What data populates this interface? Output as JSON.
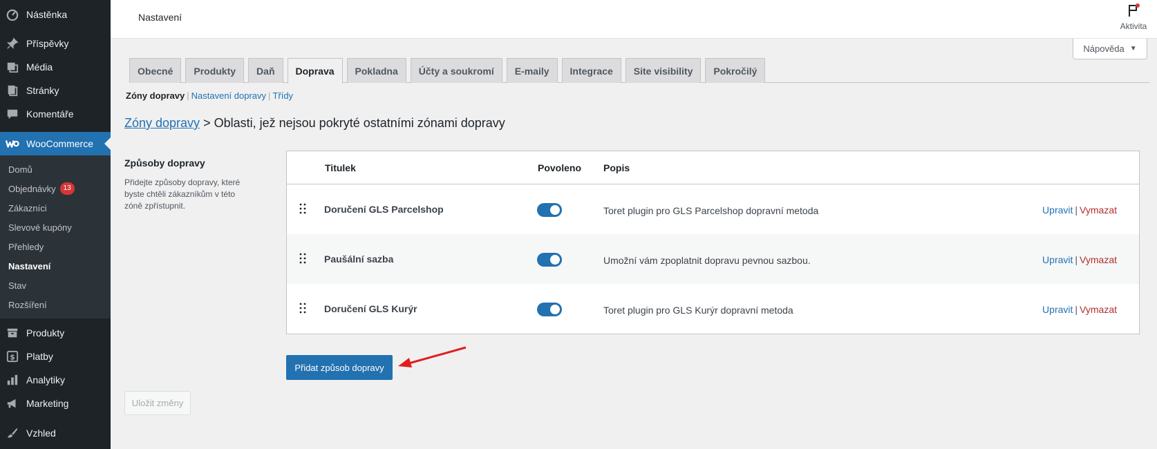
{
  "sidebar": {
    "items_top": [
      {
        "label": "Nástěnka",
        "icon": "dashboard-icon"
      },
      {
        "label": "Příspěvky",
        "icon": "pin-icon"
      },
      {
        "label": "Média",
        "icon": "media-icon"
      },
      {
        "label": "Stránky",
        "icon": "pages-icon"
      },
      {
        "label": "Komentáře",
        "icon": "comment-icon"
      }
    ],
    "woocommerce": {
      "label": "WooCommerce",
      "icon": "woo-icon"
    },
    "submenu": [
      {
        "label": "Domů"
      },
      {
        "label": "Objednávky",
        "badge": "13"
      },
      {
        "label": "Zákazníci"
      },
      {
        "label": "Slevové kupóny"
      },
      {
        "label": "Přehledy"
      },
      {
        "label": "Nastavení"
      },
      {
        "label": "Stav"
      },
      {
        "label": "Rozšíření"
      }
    ],
    "items_bottom": [
      {
        "label": "Produkty",
        "icon": "archive-icon"
      },
      {
        "label": "Platby",
        "icon": "dollar-icon"
      },
      {
        "label": "Analytiky",
        "icon": "chart-icon"
      },
      {
        "label": "Marketing",
        "icon": "megaphone-icon"
      },
      {
        "label": "Vzhled",
        "icon": "brush-icon"
      }
    ]
  },
  "topbar": {
    "title": "Nastavení",
    "activity_label": "Aktivita",
    "help_label": "Nápověda"
  },
  "tabs": [
    "Obecné",
    "Produkty",
    "Daň",
    "Doprava",
    "Pokladna",
    "Účty a soukromí",
    "E-maily",
    "Integrace",
    "Site visibility",
    "Pokročilý"
  ],
  "active_tab": "Doprava",
  "subsub": {
    "current": "Zóny dopravy",
    "link1": "Nastavení dopravy",
    "link2": "Třídy"
  },
  "breadcrumb": {
    "link": "Zóny dopravy",
    "sep": ">",
    "current": "Oblasti, jež nejsou pokryté ostatními zónami dopravy"
  },
  "section": {
    "title": "Způsoby dopravy",
    "description": "Přidejte způsoby dopravy, které byste chtěli zákazníkům v této zóně zpřístupnit."
  },
  "table": {
    "headers": {
      "title": "Titulek",
      "enabled": "Povoleno",
      "description": "Popis"
    },
    "rows": [
      {
        "name": "Doručení GLS Parcelshop",
        "enabled": true,
        "description": "Toret plugin pro GLS Parcelshop dopravní metoda",
        "edit": "Upravit",
        "sep": "|",
        "delete": "Vymazat"
      },
      {
        "name": "Paušální sazba",
        "enabled": true,
        "description": "Umožní vám zpoplatnit dopravu pevnou sazbou.",
        "edit": "Upravit",
        "sep": "|",
        "delete": "Vymazat"
      },
      {
        "name": "Doručení GLS Kurýr",
        "enabled": true,
        "description": "Toret plugin pro GLS Kurýr dopravní metoda",
        "edit": "Upravit",
        "sep": "|",
        "delete": "Vymazat"
      }
    ]
  },
  "buttons": {
    "add": "Přidat způsob dopravy",
    "save": "Uložit změny"
  },
  "colors": {
    "accent": "#2271b1",
    "sidebar": "#1d2327",
    "danger": "#b32d2e",
    "arrow": "#e01e1e"
  }
}
